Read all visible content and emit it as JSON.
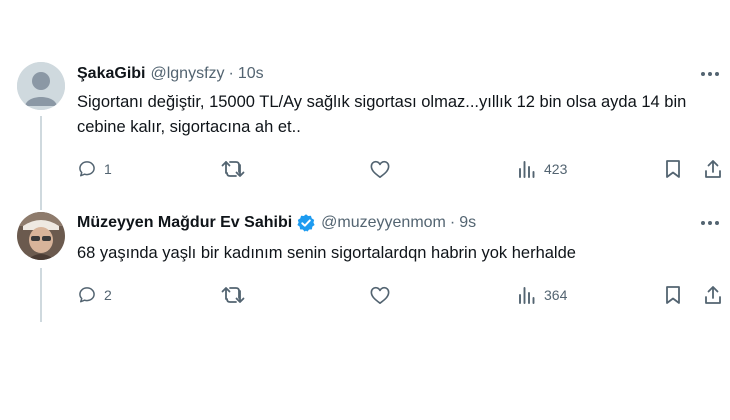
{
  "tweets": [
    {
      "name": "ŞakaGibi",
      "handle": "@lgnysfzy",
      "time": "10s",
      "verified": false,
      "text": "Sigortanı değiştir, 15000 TL/Ay sağlık sigortası olmaz...yıllık 12 bin olsa ayda 14 bin cebine kalır, sigortacına ah et..",
      "replies": "1",
      "reposts": "",
      "likes": "",
      "views": "423"
    },
    {
      "name": "Müzeyyen Mağdur Ev Sahibi",
      "handle": "@muzeyyenmom",
      "time": "9s",
      "verified": true,
      "text": "68 yaşında yaşlı bir kadınım senin sigortalardqn habrin yok herhalde",
      "replies": "2",
      "reposts": "",
      "likes": "",
      "views": "364"
    }
  ],
  "colors": {
    "text": "#0f1419",
    "secondary": "#536471",
    "verified": "#1d9bf0",
    "thread_line": "#cfd9de"
  },
  "icons": {
    "reply": "reply-icon",
    "repost": "repost-icon",
    "like": "heart-icon",
    "views": "views-icon",
    "bookmark": "bookmark-icon",
    "share": "share-icon",
    "more": "more-icon",
    "verified": "verified-badge-icon"
  }
}
